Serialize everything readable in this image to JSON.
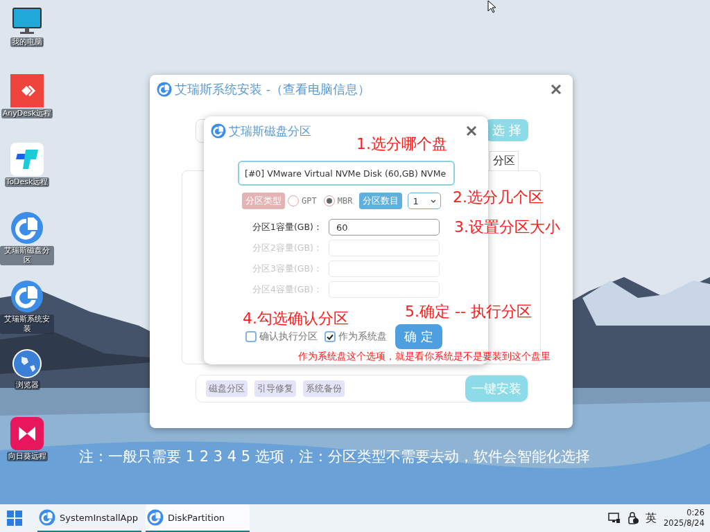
{
  "desktop_icons": [
    {
      "label": "我的电脑",
      "kind": "monitor"
    },
    {
      "label": "AnyDesk远程",
      "kind": "anydesk"
    },
    {
      "label": "ToDesk远程",
      "kind": "todesk"
    },
    {
      "label": "艾瑞斯磁盘分区",
      "kind": "app"
    },
    {
      "label": "艾瑞斯系统安装",
      "kind": "app"
    },
    {
      "label": "浏览器",
      "kind": "globe"
    },
    {
      "label": "向日葵远程",
      "kind": "sunlogin"
    }
  ],
  "main_window": {
    "title": "艾瑞斯系统安装 -（查看电脑信息）",
    "select_button": "选 择",
    "tab": "分区",
    "tools": [
      "磁盘分区",
      "引导修复",
      "系统备份"
    ],
    "install_button": "一键安装"
  },
  "dialog": {
    "title": "艾瑞斯磁盘分区",
    "disk_select": "[#0] VMware Virtual NVMe Disk (60,GB) NVMe",
    "type_label": "分区类型",
    "type_options": [
      {
        "label": "GPT",
        "selected": false
      },
      {
        "label": "MBR",
        "selected": true
      }
    ],
    "count_label": "分区数目",
    "count_value": "1",
    "capacities": [
      {
        "label": "分区1容量(GB)：",
        "value": "60",
        "disabled": false
      },
      {
        "label": "分区2容量(GB)：",
        "disabled": true
      },
      {
        "label": "分区3容量(GB)：",
        "disabled": true
      },
      {
        "label": "分区4容量(GB)：",
        "disabled": true
      }
    ],
    "checks": [
      {
        "label": "确认执行分区",
        "checked": false
      },
      {
        "label": "作为系统盘",
        "checked": true
      }
    ],
    "confirm_button": "确 定"
  },
  "annotations": [
    {
      "text": "1.选分哪个盘",
      "kind": "step"
    },
    {
      "text": "2.选分几个区",
      "kind": "step"
    },
    {
      "text": "3.设置分区大小",
      "kind": "step"
    },
    {
      "text": "4.勾选确认分区",
      "kind": "step"
    },
    {
      "text": "5.确定 -- 执行分区",
      "kind": "step"
    },
    {
      "text": "作为系统盘这个选项，就是看你系统是不是要装到这个盘里",
      "kind": "note"
    }
  ],
  "footer_note": "注：一般只需要 1 2 3 4 5 选项，注：分区类型不需要去动，软件会智能化选择",
  "taskbar": {
    "apps": [
      {
        "label": "SystemInstallApp",
        "selected": false
      },
      {
        "label": "DiskPartition",
        "selected": true
      }
    ],
    "ime": "英",
    "time": "0:26",
    "date": "2025/8/24"
  }
}
